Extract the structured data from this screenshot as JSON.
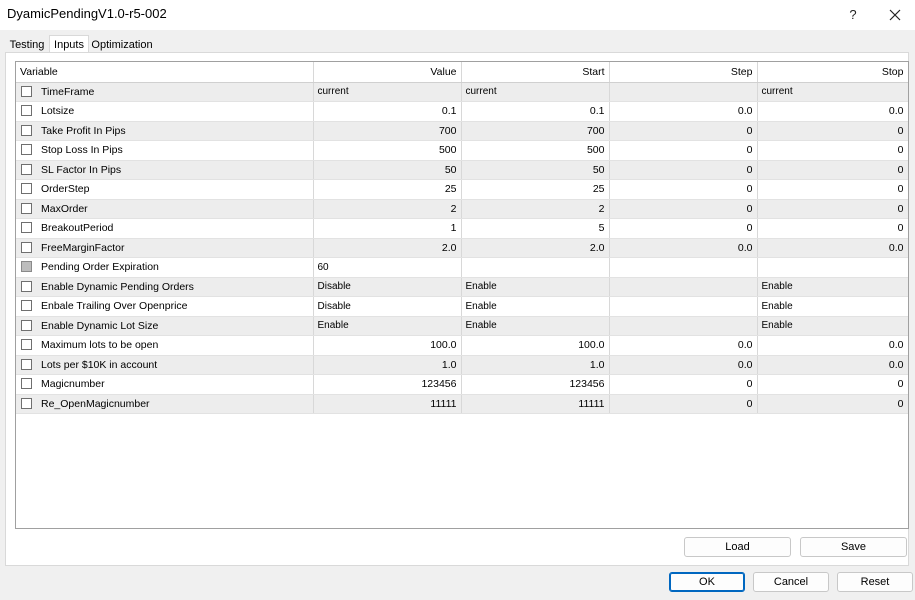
{
  "window": {
    "title": "DyamicPendingV1.0-r5-002",
    "help_label": "?",
    "close_icon": "close-icon"
  },
  "tabs": [
    {
      "label": "Testing",
      "active": false
    },
    {
      "label": "Inputs",
      "active": true
    },
    {
      "label": "Optimization",
      "active": false
    }
  ],
  "grid": {
    "columns": [
      "Variable",
      "Value",
      "Start",
      "Step",
      "Stop"
    ],
    "rows": [
      {
        "name": "TimeFrame",
        "checked": false,
        "value": "current",
        "start": "current",
        "step": "",
        "stop": "current",
        "kind": "text"
      },
      {
        "name": "Lotsize",
        "checked": false,
        "value": "0.1",
        "start": "0.1",
        "step": "0.0",
        "stop": "0.0",
        "kind": "num"
      },
      {
        "name": "Take Profit In Pips",
        "checked": false,
        "value": "700",
        "start": "700",
        "step": "0",
        "stop": "0",
        "kind": "num"
      },
      {
        "name": "Stop Loss In Pips",
        "checked": false,
        "value": "500",
        "start": "500",
        "step": "0",
        "stop": "0",
        "kind": "num"
      },
      {
        "name": "SL Factor In Pips",
        "checked": false,
        "value": "50",
        "start": "50",
        "step": "0",
        "stop": "0",
        "kind": "num"
      },
      {
        "name": "OrderStep",
        "checked": false,
        "value": "25",
        "start": "25",
        "step": "0",
        "stop": "0",
        "kind": "num"
      },
      {
        "name": "MaxOrder",
        "checked": false,
        "value": "2",
        "start": "2",
        "step": "0",
        "stop": "0",
        "kind": "num"
      },
      {
        "name": "BreakoutPeriod",
        "checked": false,
        "value": "1",
        "start": "5",
        "step": "0",
        "stop": "0",
        "kind": "num"
      },
      {
        "name": "FreeMarginFactor",
        "checked": false,
        "value": "2.0",
        "start": "2.0",
        "step": "0.0",
        "stop": "0.0",
        "kind": "num"
      },
      {
        "name": "Pending Order Expiration",
        "checked": false,
        "disabled": true,
        "value": "60",
        "start": "",
        "step": "",
        "stop": "",
        "kind": "text"
      },
      {
        "name": "Enable Dynamic Pending Orders",
        "checked": false,
        "value": "Disable",
        "start": "Enable",
        "step": "",
        "stop": "Enable",
        "kind": "text"
      },
      {
        "name": "Enbale Trailing Over Openprice",
        "checked": false,
        "value": "Disable",
        "start": "Enable",
        "step": "",
        "stop": "Enable",
        "kind": "text"
      },
      {
        "name": "Enable Dynamic Lot Size",
        "checked": false,
        "value": "Enable",
        "start": "Enable",
        "step": "",
        "stop": "Enable",
        "kind": "text"
      },
      {
        "name": "Maximum lots to be open",
        "checked": false,
        "value": "100.0",
        "start": "100.0",
        "step": "0.0",
        "stop": "0.0",
        "kind": "num"
      },
      {
        "name": "Lots per $10K in account",
        "checked": false,
        "value": "1.0",
        "start": "1.0",
        "step": "0.0",
        "stop": "0.0",
        "kind": "num"
      },
      {
        "name": "Magicnumber",
        "checked": false,
        "value": "123456",
        "start": "123456",
        "step": "0",
        "stop": "0",
        "kind": "num"
      },
      {
        "name": "Re_OpenMagicnumber",
        "checked": false,
        "value": "11111",
        "start": "11111",
        "step": "0",
        "stop": "0",
        "kind": "num"
      }
    ]
  },
  "panel_buttons": {
    "load": "Load",
    "save": "Save"
  },
  "dialog_buttons": {
    "ok": "OK",
    "cancel": "Cancel",
    "reset": "Reset"
  }
}
